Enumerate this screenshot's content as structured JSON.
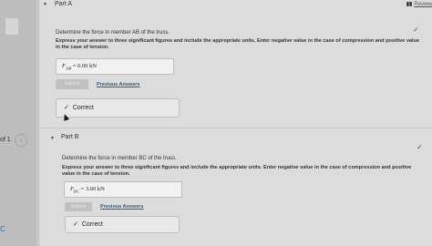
{
  "nav": {
    "page_indicator": "of 1",
    "next_icon": "chevron-right-icon",
    "bottom_glyph": "C"
  },
  "header": {
    "review_label": "Review"
  },
  "part_a": {
    "title": "Part A",
    "question": "Determine the force in member AB of the truss.",
    "instructions": "Express your answer to three significant figures and include the appropriate units. Enter negative value in the case of compression and positive value in the case of tension.",
    "answer_label": "F",
    "answer_sub": "AB",
    "answer_value": "= 6.00 kN",
    "submit_label": "Submit",
    "previous_answers": "Previous Answers",
    "feedback": "Correct"
  },
  "part_b": {
    "title": "Part B",
    "question": "Determine the force in member BC of the truss.",
    "instructions": "Express your answer to three significant figures and include the appropriate units. Enter negative value in the case of compression and positive value in the case of tension.",
    "answer_label": "F",
    "answer_sub": "BC",
    "answer_value": "= 3.60 kN",
    "submit_label": "Submit",
    "previous_answers": "Previous Answers",
    "feedback": "Correct"
  },
  "colors": {
    "correct": "#2e8b2e",
    "link": "#2b5e8c"
  }
}
